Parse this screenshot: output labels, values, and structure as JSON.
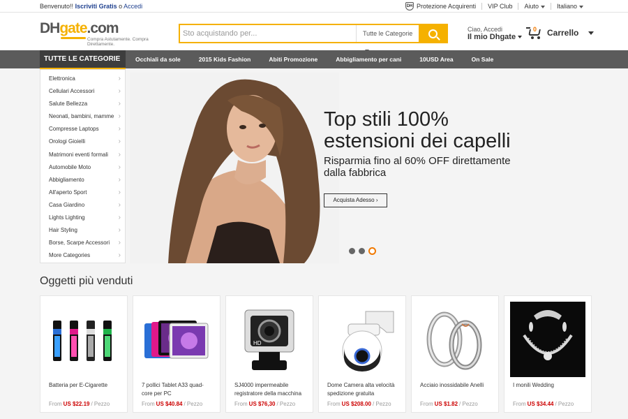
{
  "topbar": {
    "welcome": "Benvenuto!!",
    "register": "Iscriviti Gratis",
    "or": "o",
    "login": "Accedi",
    "protection": "Protezione Acquirenti",
    "vip": "VIP Club",
    "help": "Aiuto",
    "language": "Italiano"
  },
  "header": {
    "logo_dh": "DH",
    "logo_gate": "gate",
    "logo_com": ".com",
    "tagline": "Compra Astutamente. Compra Direttamente.",
    "search_placeholder": "Sto acquistando per...",
    "search_category": "Tutte le Categorie",
    "greeting": "Ciao, Accedi",
    "my_account": "Il mio Dhgate",
    "cart_count": "0",
    "cart_label": "Carrello"
  },
  "nav": {
    "all_categories": "TUTTE LE CATEGORIE",
    "links": [
      "Occhiali da sole",
      "2015 Kids Fashion",
      "Abiti Promozione",
      "Abbigliamento per cani",
      "10USD Area",
      "On Sale"
    ]
  },
  "sidebar": {
    "items": [
      "Elettronica",
      "Cellulari Accessori",
      "Salute Bellezza",
      "Neonati, bambini, mamme",
      "Compresse Laptops",
      "Orologi Gioielli",
      "Matrimoni eventi formali",
      "Automobile Moto",
      "Abbigliamento",
      "All'aperto Sport",
      "Casa Giardino",
      "Lights Lighting",
      "Hair Styling",
      "Borse, Scarpe Accessori",
      "More Categories"
    ]
  },
  "banner": {
    "title_line1": "Top stili 100%",
    "title_line2": "estensioni dei capelli",
    "subtitle": "Risparmia fino al 60% OFF direttamente dalla fabbrica",
    "cta": "Acquista Adesso",
    "slide_count": 3,
    "active_slide": 3
  },
  "bestsellers": {
    "title": "Oggetti più venduti",
    "from": "From",
    "unit": "/ Pezzo",
    "products": [
      {
        "name": "Batteria per E-Cigarette",
        "price": "US $22.19"
      },
      {
        "name": "7 pollici Tablet A33 quad-core per PC",
        "price": "US $40.84"
      },
      {
        "name": "SJ4000 impermeabile registratore della macchina",
        "price": "US $76,30"
      },
      {
        "name": "Dome Camera alta velocità spedizione gratuita",
        "price": "US $208.00"
      },
      {
        "name": "Acciaio inossidabile Anelli",
        "price": "US $1.82"
      },
      {
        "name": "I monili Wedding",
        "price": "US $34.44"
      }
    ]
  },
  "colors": {
    "accent": "#f5b100",
    "nav_bg": "#5b5b5b",
    "price": "#cc0000",
    "link": "#1d3f8e"
  }
}
